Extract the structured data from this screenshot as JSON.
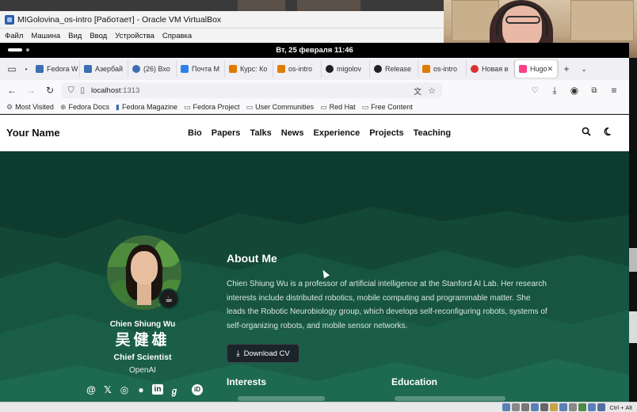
{
  "vbox": {
    "window_title": "MIGolovina_os-intro [Работает] - Oracle VM VirtualBox",
    "menu": [
      "Файл",
      "Машина",
      "Вид",
      "Ввод",
      "Устройства",
      "Справка"
    ],
    "status_host_key": "Ctrl + Alt"
  },
  "gnome": {
    "clock": "Вт, 25 февраля  11:46"
  },
  "firefox": {
    "tabs": [
      {
        "label": "Fedora W",
        "icon": "fedora-icon",
        "color": "#3c6eb4"
      },
      {
        "label": "Азербай",
        "icon": "globe-icon",
        "color": "#3c6eb4"
      },
      {
        "label": "(26) Вхо",
        "icon": "mail-icon",
        "color": "#3c6eb4"
      },
      {
        "label": "Почта M",
        "icon": "mail-icon",
        "color": "#2f80ed"
      },
      {
        "label": "Курс: Ко",
        "icon": "course-icon",
        "color": "#e07b00"
      },
      {
        "label": "os-intro",
        "icon": "course-icon",
        "color": "#e07b00"
      },
      {
        "label": "migolov",
        "icon": "github-icon",
        "color": "#222222"
      },
      {
        "label": "Release",
        "icon": "github-icon",
        "color": "#222222"
      },
      {
        "label": "os-intro",
        "icon": "course-icon",
        "color": "#e07b00"
      },
      {
        "label": "Новая в",
        "icon": "apple-icon",
        "color": "#d8322f"
      },
      {
        "label": "Hugo",
        "icon": "hugo-icon",
        "color": "#ff4088",
        "active": true
      }
    ],
    "url": "localhost",
    "url_port": ":1313",
    "bookmarks": [
      "Most Visited",
      "Fedora Docs",
      "Fedora Magazine",
      "Fedora Project",
      "User Communities",
      "Red Hat",
      "Free Content"
    ]
  },
  "site": {
    "brand": "Your Name",
    "nav": [
      "Bio",
      "Papers",
      "Talks",
      "News",
      "Experience",
      "Projects",
      "Teaching"
    ],
    "profile": {
      "name": "Chien Shiung Wu",
      "name_cn": "吴健雄",
      "role": "Chief Scientist",
      "org": "OpenAI",
      "social_icons": [
        "at-icon",
        "x-icon",
        "instagram-icon",
        "github-icon",
        "linkedin-icon",
        "scholar-icon",
        "orcid-icon"
      ]
    },
    "about_title": "About Me",
    "about_text": "Chien Shiung Wu is a professor of artificial intelligence at the Stanford AI Lab. Her research interests include distributed robotics, mobile computing and programmable matter. She leads the Robotic Neurobiology group, which develops self-reconfiguring robots, systems of self-organizing robots, and mobile sensor networks.",
    "cv_button": "Download CV",
    "interests_title": "Interests",
    "education_title": "Education"
  },
  "colors": {
    "hero_bg": "#0d3b2e",
    "accent": "#ff4088"
  }
}
